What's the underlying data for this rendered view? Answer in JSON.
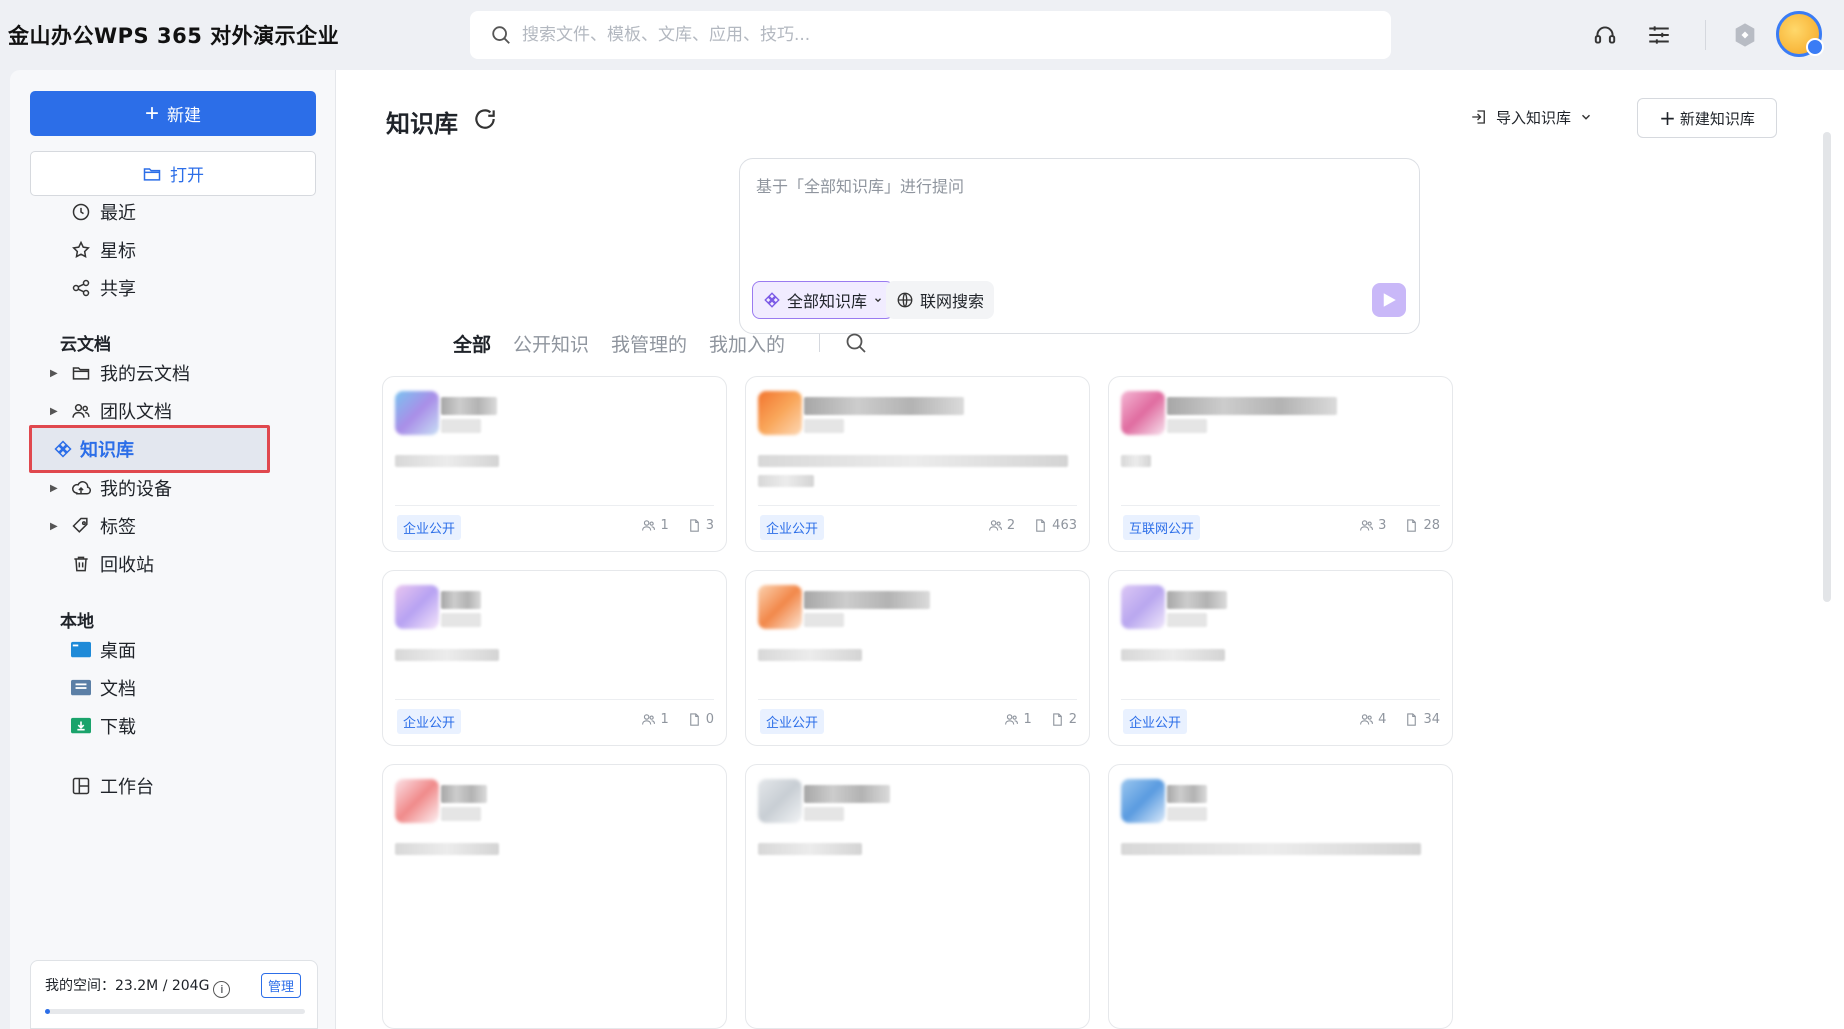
{
  "app": {
    "title": "金山办公WPS 365 对外演示企业"
  },
  "search": {
    "placeholder": "搜索文件、模板、文库、应用、技巧..."
  },
  "sidebar": {
    "new_label": "新建",
    "open_label": "打开",
    "quick": [
      {
        "label": "最近"
      },
      {
        "label": "星标"
      },
      {
        "label": "共享"
      }
    ],
    "cloud_section": "云文档",
    "cloud_items": [
      {
        "label": "我的云文档"
      },
      {
        "label": "团队文档"
      },
      {
        "label": "知识库"
      },
      {
        "label": "我的设备"
      },
      {
        "label": "标签"
      },
      {
        "label": "回收站"
      }
    ],
    "local_section": "本地",
    "local_items": [
      {
        "label": "桌面"
      },
      {
        "label": "文档"
      },
      {
        "label": "下载"
      }
    ],
    "workbench_label": "工作台",
    "storage": {
      "text": "我的空间：23.2M / 204G",
      "info": "i",
      "manage": "管理",
      "used_fraction": 0.02
    }
  },
  "main": {
    "title": "知识库",
    "import_label": "导入知识库",
    "new_kb_label": "新建知识库",
    "ask": {
      "placeholder": "基于「全部知识库」进行提问",
      "scope_label": "全部知识库",
      "web_search_label": "联网搜索"
    },
    "tabs": [
      {
        "label": "全部",
        "active": true
      },
      {
        "label": "公开知识",
        "active": false
      },
      {
        "label": "我管理的",
        "active": false
      },
      {
        "label": "我加入的",
        "active": false
      }
    ],
    "cards": [
      {
        "tag": "企业公开",
        "members": "1",
        "docs": "3"
      },
      {
        "tag": "企业公开",
        "members": "2",
        "docs": "463"
      },
      {
        "tag": "互联网公开",
        "members": "3",
        "docs": "28"
      },
      {
        "tag": "企业公开",
        "members": "1",
        "docs": "0"
      },
      {
        "tag": "企业公开",
        "members": "1",
        "docs": "2"
      },
      {
        "tag": "企业公开",
        "members": "4",
        "docs": "34"
      }
    ]
  }
}
